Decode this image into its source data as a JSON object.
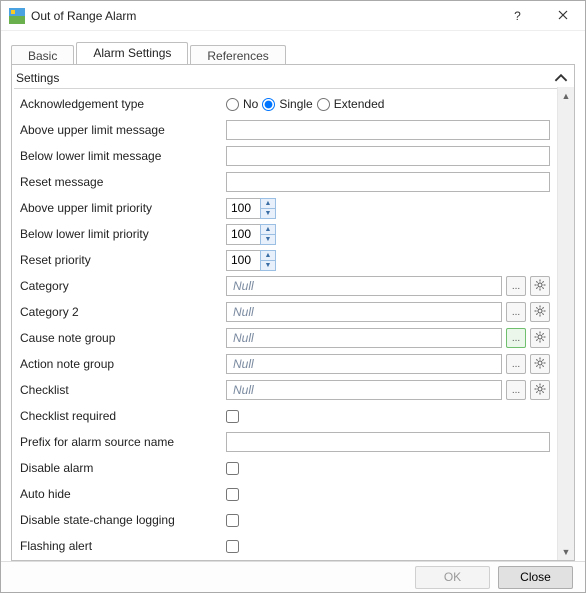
{
  "window": {
    "title": "Out of Range Alarm"
  },
  "tabs": [
    {
      "label": "Basic"
    },
    {
      "label": "Alarm Settings"
    },
    {
      "label": "References"
    }
  ],
  "section": {
    "title": "Settings"
  },
  "ack": {
    "label": "Acknowledgement type",
    "options": {
      "no": "No",
      "single": "Single",
      "extended": "Extended"
    },
    "selected": "single"
  },
  "fields": {
    "above_msg": {
      "label": "Above upper limit message",
      "value": ""
    },
    "below_msg": {
      "label": "Below lower limit message",
      "value": ""
    },
    "reset_msg": {
      "label": "Reset message",
      "value": ""
    },
    "above_pri": {
      "label": "Above upper limit priority",
      "value": "100"
    },
    "below_pri": {
      "label": "Below lower limit priority",
      "value": "100"
    },
    "reset_pri": {
      "label": "Reset priority",
      "value": "100"
    },
    "category": {
      "label": "Category",
      "value": "Null"
    },
    "category2": {
      "label": "Category 2",
      "value": "Null"
    },
    "cause_grp": {
      "label": "Cause note group",
      "value": "Null"
    },
    "action_grp": {
      "label": "Action note group",
      "value": "Null"
    },
    "checklist": {
      "label": "Checklist",
      "value": "Null"
    },
    "checklist_req": {
      "label": "Checklist required",
      "checked": false
    },
    "prefix": {
      "label": "Prefix for alarm source name",
      "value": ""
    },
    "disable_alarm": {
      "label": "Disable alarm",
      "checked": false
    },
    "auto_hide": {
      "label": "Auto hide",
      "checked": false
    },
    "disable_state_log": {
      "label": "Disable state-change logging",
      "checked": false
    },
    "flashing": {
      "label": "Flashing alert",
      "checked": false
    }
  },
  "buttons": {
    "ok": "OK",
    "close": "Close",
    "browse": "..."
  }
}
